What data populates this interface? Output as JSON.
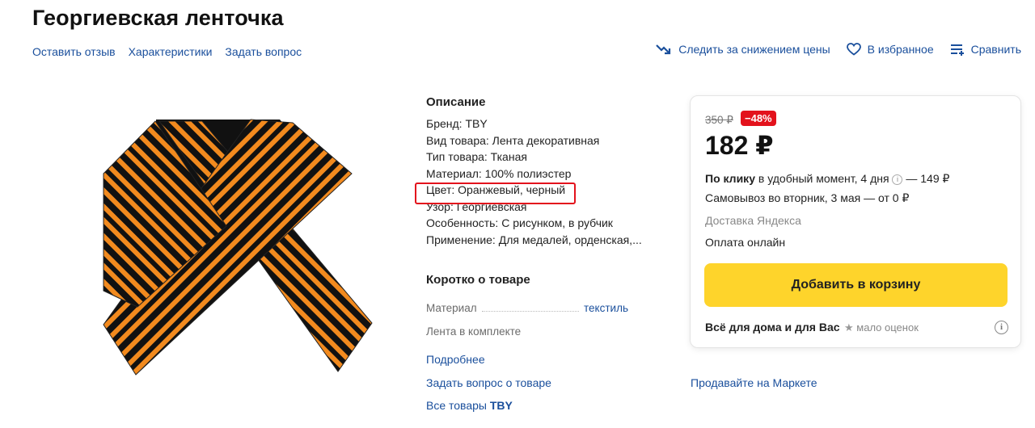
{
  "title": "Георгиевская ленточка",
  "subnav": [
    "Оставить отзыв",
    "Характеристики",
    "Задать вопрос"
  ],
  "actions": {
    "track_price": "Следить за снижением цены",
    "favorite": "В избранное",
    "compare": "Сравнить"
  },
  "description": {
    "heading": "Описание",
    "rows": [
      "Бренд: TBY",
      "Вид товара: Лента декоративная",
      "Тип товара: Тканая",
      "Материал: 100% полиэстер",
      "Цвет: Оранжевый, черный",
      "Узор: Георгиевская",
      "Особенность: С рисунком, в рубчик",
      "Применение: Для медалей, орденская,..."
    ]
  },
  "short": {
    "heading": "Коротко о товаре",
    "spec_label": "Материал",
    "spec_value": "текстиль",
    "spec2": "Лента в комплекте",
    "more": "Подробнее",
    "ask": "Задать вопрос о товаре",
    "all_goods_prefix": "Все товары ",
    "brand": "TBY"
  },
  "offer": {
    "old_price": "350 ₽",
    "discount": "−48%",
    "price": "182 ₽",
    "delivery1_bold": "По клику",
    "delivery1_rest": " в удобный момент, 4 дня ",
    "delivery1_tail": " — 149 ₽",
    "delivery2": "Самовывоз во вторник, 3 мая — от 0 ₽",
    "delivery3": "Доставка Яндекса",
    "payment": "Оплата онлайн",
    "add_to_cart": "Добавить в корзину",
    "shop": "Всё для дома и для Вас",
    "rating": "мало оценок"
  },
  "sell": "Продавайте на Маркете",
  "colors": {
    "link": "#1a4f9c",
    "accent_button": "#fed42b",
    "discount": "#e3121c",
    "ribbon_orange": "#f28a1e",
    "ribbon_black": "#111111"
  }
}
